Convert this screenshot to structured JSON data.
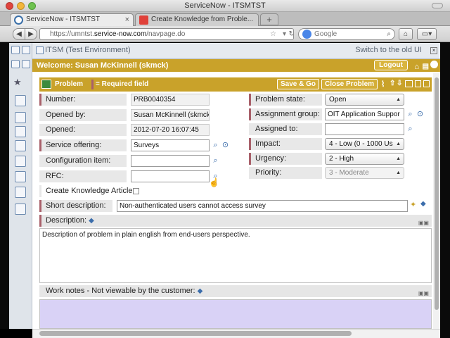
{
  "window": {
    "title": "ServiceNow - ITSMTST"
  },
  "tabs": [
    {
      "label": "ServiceNow - ITSMTST",
      "active": true
    },
    {
      "label": "Create Knowledge from Proble...",
      "active": false
    }
  ],
  "nav": {
    "back": "◀",
    "forward": "▶",
    "url_prefix": "https://umntst.",
    "url_host": "service-now.com",
    "url_path": "/navpage.do",
    "search_placeholder": "Google"
  },
  "banner": {
    "title": "ITSM (Test Environment)",
    "switch_link": "Switch to the old UI"
  },
  "welcome": {
    "text": "Welcome: Susan McKinnell (skmck)",
    "logout": "Logout"
  },
  "form": {
    "title": "Problem",
    "required_legend": "= Required field",
    "save_go": "Save & Go",
    "close_problem": "Close Problem",
    "number": {
      "label": "Number:",
      "value": "PRB0040354"
    },
    "opened_by": {
      "label": "Opened by:",
      "value": "Susan McKinnell (skmck"
    },
    "opened": {
      "label": "Opened:",
      "value": "2012-07-20 16:07:45"
    },
    "service_offering": {
      "label": "Service offering:",
      "value": "Surveys"
    },
    "configuration_item": {
      "label": "Configuration item:",
      "value": ""
    },
    "rfc": {
      "label": "RFC:",
      "value": ""
    },
    "create_knowledge": {
      "label": "Create Knowledge Article:"
    },
    "problem_state": {
      "label": "Problem state:",
      "value": "Open"
    },
    "assignment_group": {
      "label": "Assignment group:",
      "value": "OIT Application Suppor"
    },
    "assigned_to": {
      "label": "Assigned to:",
      "value": ""
    },
    "impact": {
      "label": "Impact:",
      "value": "4 - Low (0 - 1000 Us"
    },
    "urgency": {
      "label": "Urgency:",
      "value": "2 - High"
    },
    "priority": {
      "label": "Priority:",
      "value": "3 - Moderate"
    },
    "short_description": {
      "label": "Short description:",
      "value": "Non-authenticated users cannot access survey"
    },
    "description": {
      "label": "Description:",
      "value": "Description of problem in plain english from end-users perspective."
    },
    "work_notes": {
      "label": "Work notes - Not viewable by the customer:"
    }
  },
  "colors": {
    "accent": "#c9a22a",
    "mandatory": "#a8606a",
    "work_notes_bg": "#d9d2f6"
  }
}
